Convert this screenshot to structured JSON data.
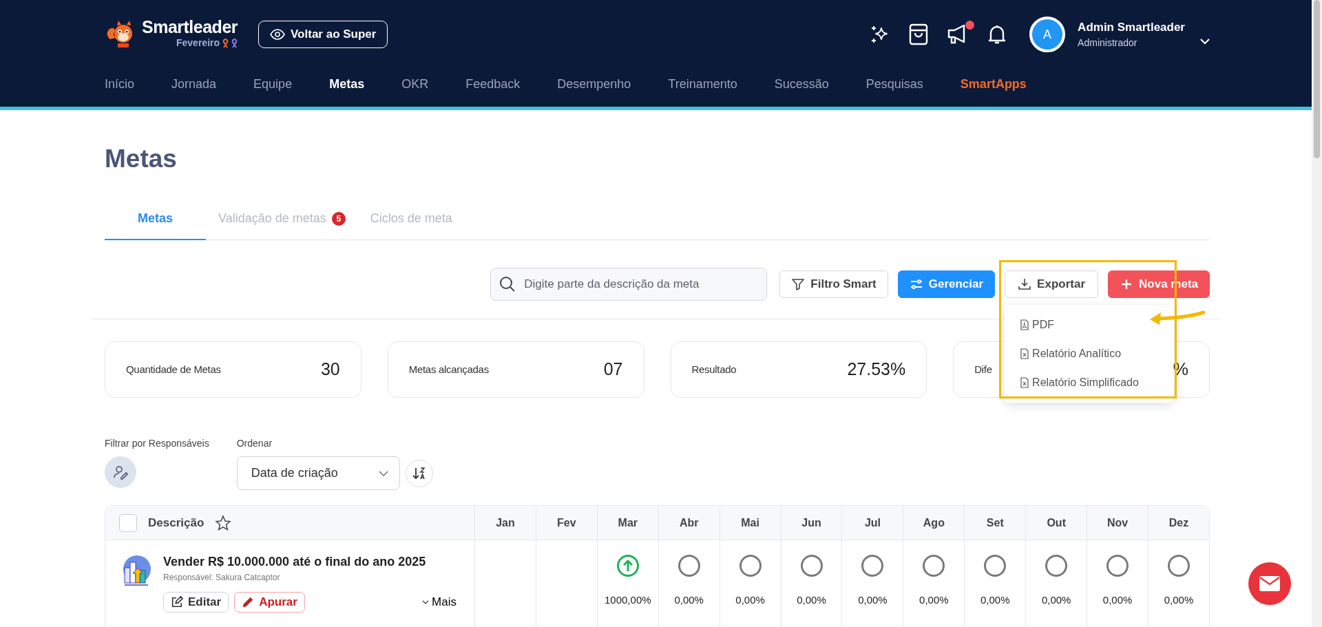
{
  "header": {
    "brand": "Smartleader",
    "month": "Fevereiro",
    "back_button": "Voltar ao Super",
    "announcements_unread": true,
    "user": {
      "initial": "A",
      "name": "Admin Smartleader",
      "role": "Administrador"
    }
  },
  "nav": [
    {
      "label": "Início",
      "selected": false,
      "kind": "link"
    },
    {
      "label": "Jornada",
      "selected": false,
      "kind": "link"
    },
    {
      "label": "Equipe",
      "selected": false,
      "kind": "link"
    },
    {
      "label": "Metas",
      "selected": true,
      "kind": "link"
    },
    {
      "label": "OKR",
      "selected": false,
      "kind": "link"
    },
    {
      "label": "Feedback",
      "selected": false,
      "kind": "link"
    },
    {
      "label": "Desempenho",
      "selected": false,
      "kind": "link"
    },
    {
      "label": "Treinamento",
      "selected": false,
      "kind": "link"
    },
    {
      "label": "Sucessão",
      "selected": false,
      "kind": "link"
    },
    {
      "label": "Pesquisas",
      "selected": false,
      "kind": "link"
    },
    {
      "label": "SmartApps",
      "selected": false,
      "kind": "apps"
    }
  ],
  "page_title": "Metas",
  "tabs": [
    {
      "label": "Metas",
      "selected": true
    },
    {
      "label": "Validação de metas",
      "selected": false,
      "badge": "5"
    },
    {
      "label": "Ciclos de meta",
      "selected": false
    }
  ],
  "toolbar": {
    "search": {
      "placeholder": "Digite parte da descrição da meta"
    },
    "buttons": [
      {
        "label": "Filtro Smart",
        "kind": "filter"
      },
      {
        "label": "Gerenciar",
        "kind": "manage"
      },
      {
        "label": "Exportar",
        "kind": "export"
      },
      {
        "label": "Nova meta",
        "kind": "new"
      }
    ]
  },
  "export_menu": {
    "expanded": true,
    "items": [
      {
        "label": "PDF",
        "kind": "pdf"
      },
      {
        "label": "Relatório Analítico",
        "kind": "sheet"
      },
      {
        "label": "Relatório Simplificado",
        "kind": "sheet"
      }
    ]
  },
  "stats": [
    {
      "label": "Quantidade de Metas",
      "value": "30"
    },
    {
      "label": "Metas alcançadas",
      "value": "07"
    },
    {
      "label": "Resultado",
      "value": "27.53%"
    },
    {
      "label": "Dife",
      "value": "%"
    }
  ],
  "filters": {
    "responsible_label": "Filtrar por Responsáveis",
    "order_label": "Ordenar",
    "order_value": "Data de criação"
  },
  "table": {
    "select_all_checked": false,
    "starred": false,
    "columns": [
      "Descrição",
      "Jan",
      "Fev",
      "Mar",
      "Abr",
      "Mai",
      "Jun",
      "Jul",
      "Ago",
      "Set",
      "Out",
      "Nov",
      "Dez"
    ],
    "rows": [
      {
        "title": "Vender R$ 10.000.000 até o final do ano 2025",
        "responsible": "Responsável: Sakura Catcaptor",
        "actions": [
          {
            "label": "Editar",
            "kind": "edit"
          },
          {
            "label": "Apurar",
            "kind": "measure"
          }
        ],
        "more": "Mais",
        "months": [
          {
            "kind": "empty"
          },
          {
            "kind": "empty"
          },
          {
            "kind": "up",
            "percent": "1000,00%"
          },
          {
            "kind": "pending",
            "percent": "0,00%"
          },
          {
            "kind": "pending",
            "percent": "0,00%"
          },
          {
            "kind": "pending",
            "percent": "0,00%"
          },
          {
            "kind": "pending",
            "percent": "0,00%"
          },
          {
            "kind": "pending",
            "percent": "0,00%"
          },
          {
            "kind": "pending",
            "percent": "0,00%"
          },
          {
            "kind": "pending",
            "percent": "0,00%"
          },
          {
            "kind": "pending",
            "percent": "0,00%"
          },
          {
            "kind": "pending",
            "percent": "0,00%"
          }
        ]
      }
    ]
  }
}
